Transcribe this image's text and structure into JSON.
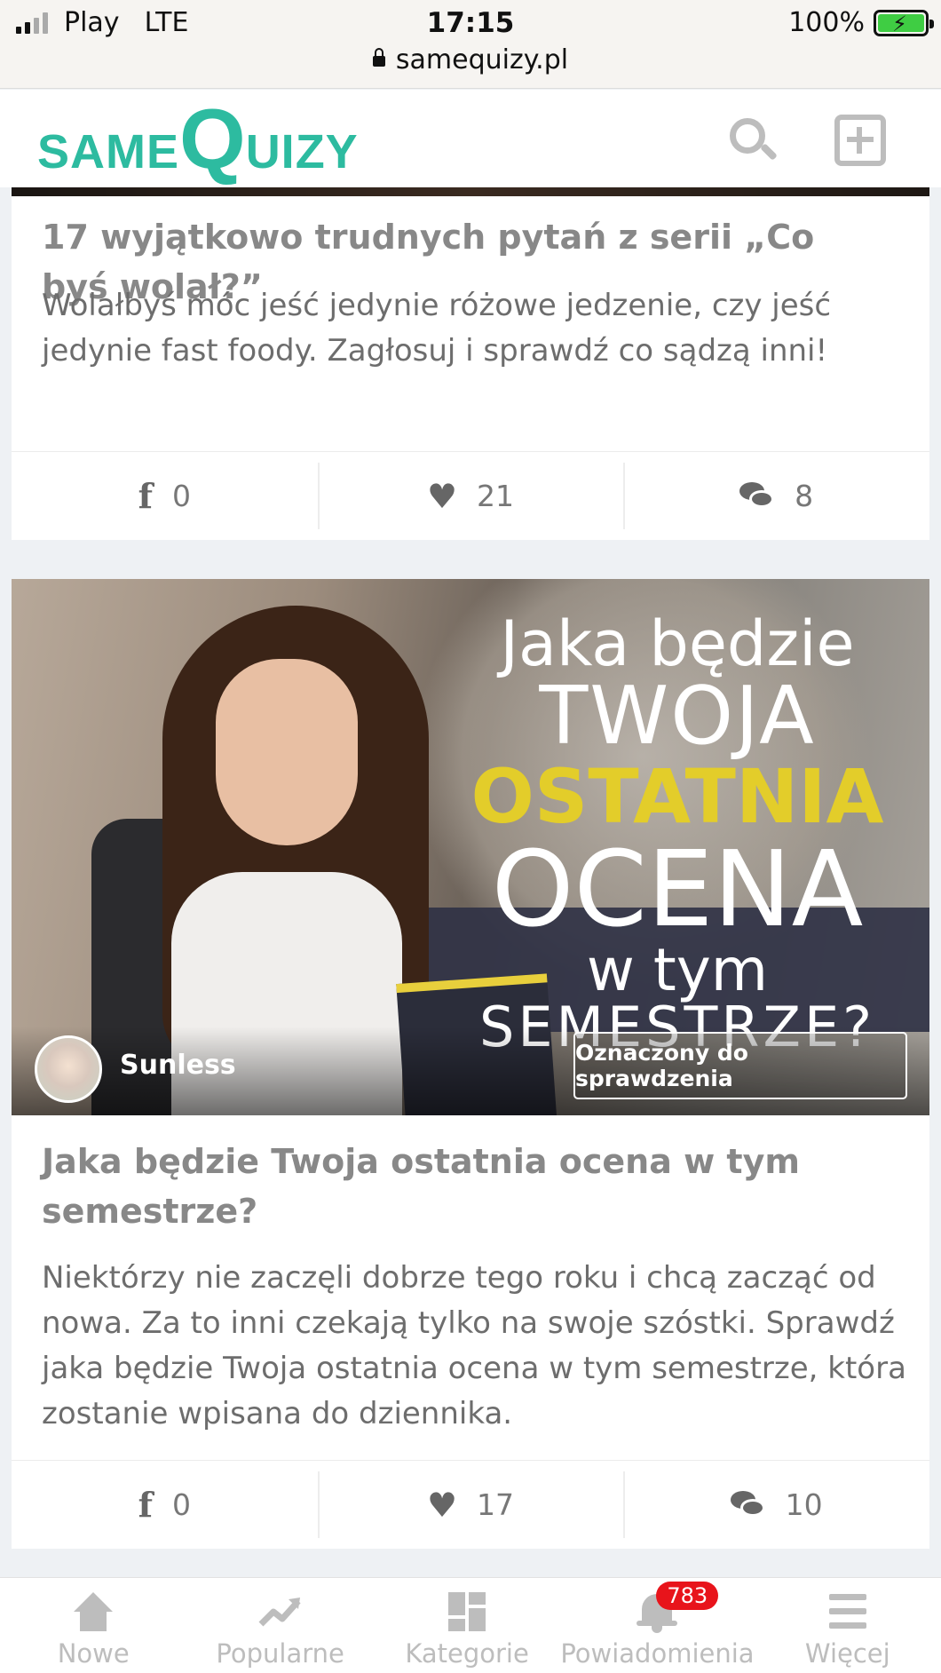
{
  "status_bar": {
    "carrier": "Play",
    "network": "LTE",
    "time": "17:15",
    "battery": "100%",
    "url": "samequizy.pl"
  },
  "header": {
    "logo_small_1": "SAME",
    "logo_big": "Q",
    "logo_small_2": "UIZY",
    "logo_color": "#2dbba0",
    "icons": [
      "search-icon",
      "add-icon"
    ]
  },
  "quizzes": [
    {
      "title": "17 wyjątkowo trudnych pytań z serii „Co byś wolał?”",
      "description": "Wolałbyś móc jeść jedynie różowe jedzenie, czy jeść jedynie fast foody. Zagłosuj i sprawdź co sądzą inni!",
      "shares": "0",
      "likes": "21",
      "comments": "8"
    },
    {
      "image_text": [
        "Jaka będzie",
        "TWOJA",
        "OSTATNIA",
        "OCENA",
        "w tym",
        "SEMESTRZE?"
      ],
      "author": "Sunless",
      "flag": "Oznaczony do sprawdzenia",
      "title": "Jaka będzie Twoja ostatnia ocena w tym semestrze?",
      "description": "Niektórzy nie zaczęli dobrze tego roku i chcą zacząć od nowa. Za to inni czekają tylko na swoje szóstki. Sprawdź jaka będzie Twoja ostatnia ocena w tym semestrze, która zostanie wpisana do dziennika.",
      "shares": "0",
      "likes": "17",
      "comments": "10"
    }
  ],
  "bottom_nav": {
    "items": [
      {
        "label": "Nowe",
        "icon": "home-icon"
      },
      {
        "label": "Popularne",
        "icon": "trending-icon"
      },
      {
        "label": "Kategorie",
        "icon": "grid-icon"
      },
      {
        "label": "Powiadomienia",
        "icon": "bell-icon",
        "badge": "783"
      },
      {
        "label": "Więcej",
        "icon": "menu-icon"
      }
    ]
  },
  "colors": {
    "accent": "#2dbba0",
    "badge": "#e8141b",
    "highlight_text": "#e3cd2a"
  }
}
